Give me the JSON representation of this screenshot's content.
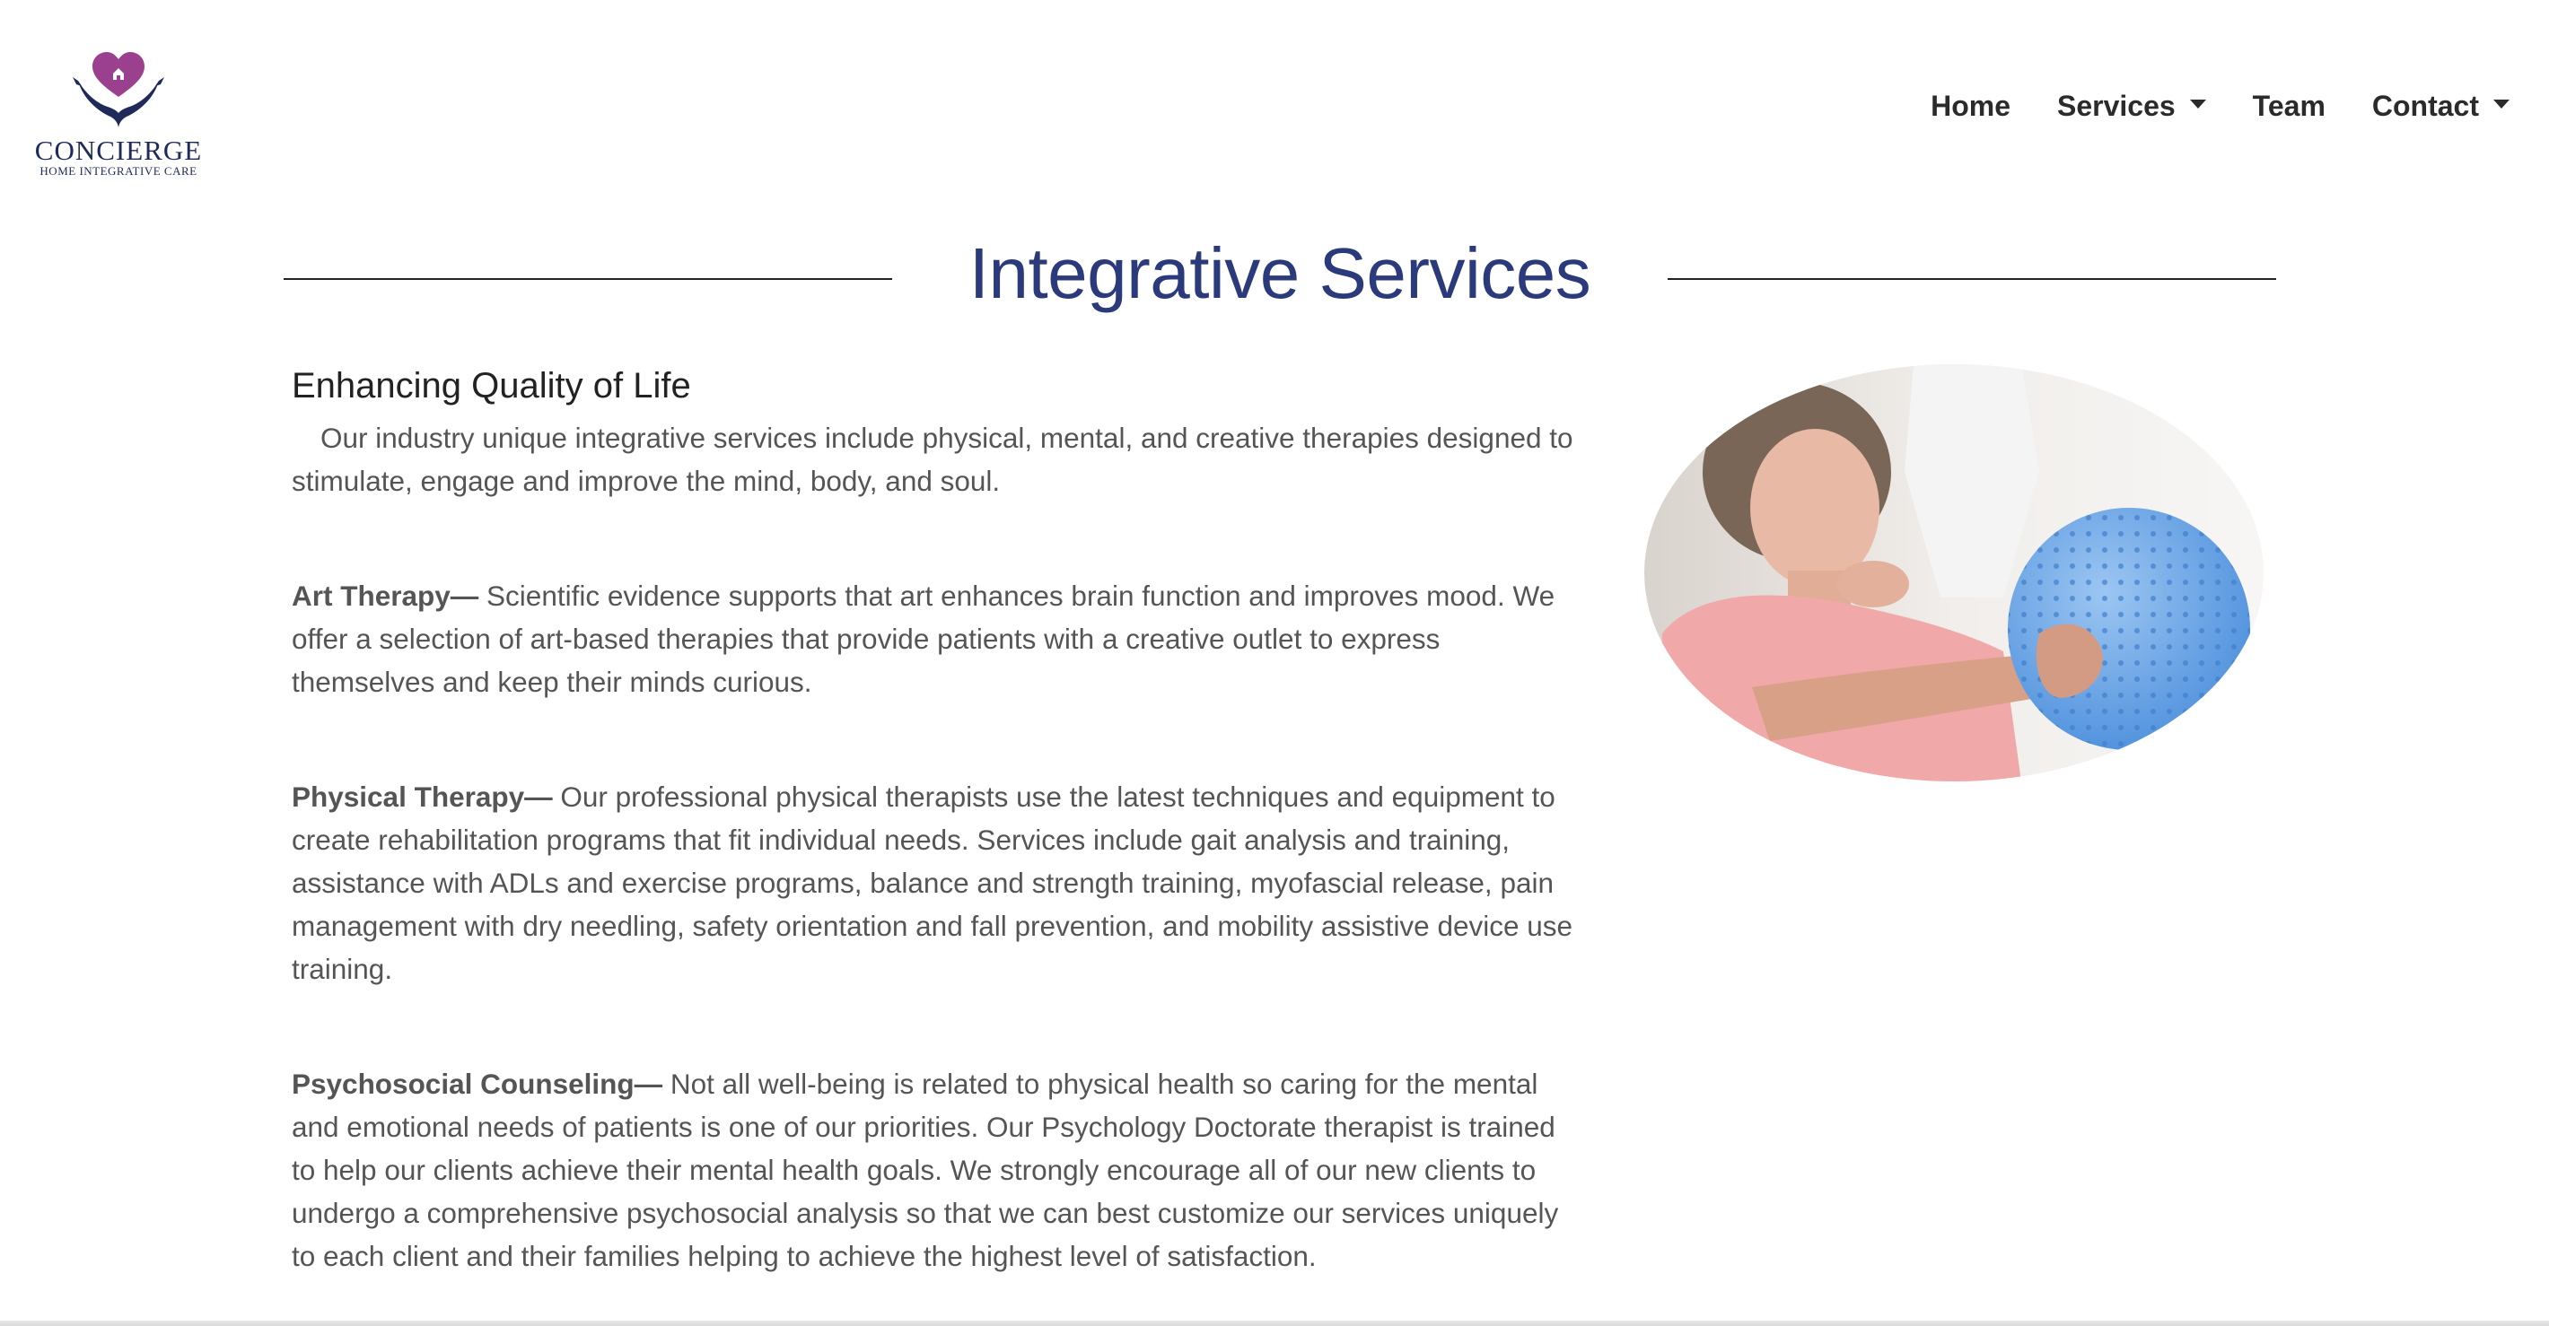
{
  "brand": {
    "name": "CONCIERGE",
    "tagline": "HOME INTEGRATIVE CARE",
    "colors": {
      "heart": "#9b3f8f",
      "hands": "#1f2a5a"
    }
  },
  "nav": {
    "items": [
      {
        "label": "Home",
        "dropdown": false
      },
      {
        "label": "Services",
        "dropdown": true
      },
      {
        "label": "Team",
        "dropdown": false
      },
      {
        "label": "Contact",
        "dropdown": true
      }
    ]
  },
  "section": {
    "title": "Integrative Services",
    "title_color": "#2b3a7a",
    "subheading": "Enhancing Quality of Life",
    "intro": "Our industry unique integrative services include physical, mental, and creative therapies designed to stimulate, engage and improve the mind, body, and soul.",
    "therapies": [
      {
        "name": "Art Therapy—",
        "text": " Scientific evidence supports that art enhances brain function and improves mood. We offer a selection of art-based therapies that provide patients with a creative outlet to express themselves and keep their minds curious."
      },
      {
        "name": "Physical Therapy—",
        "text": " Our professional physical therapists use the latest techniques and equipment to create rehabilitation programs that fit individual needs. Services include gait analysis and training, assistance with ADLs and exercise programs, balance and strength training, myofascial release, pain management with dry needling, safety orientation and fall prevention, and mobility assistive device use training."
      },
      {
        "name": "Psychosocial Counseling—",
        "text": " Not all well-being is related to physical health so caring for the mental and emotional needs of patients is one of our priorities. Our Psychology Doctorate therapist is trained to help our clients achieve their mental health goals. We strongly encourage all of our new clients to undergo a comprehensive psychosocial analysis so that we can best customize our services uniquely to each client and their families helping to achieve the highest level of satisfaction."
      }
    ]
  }
}
